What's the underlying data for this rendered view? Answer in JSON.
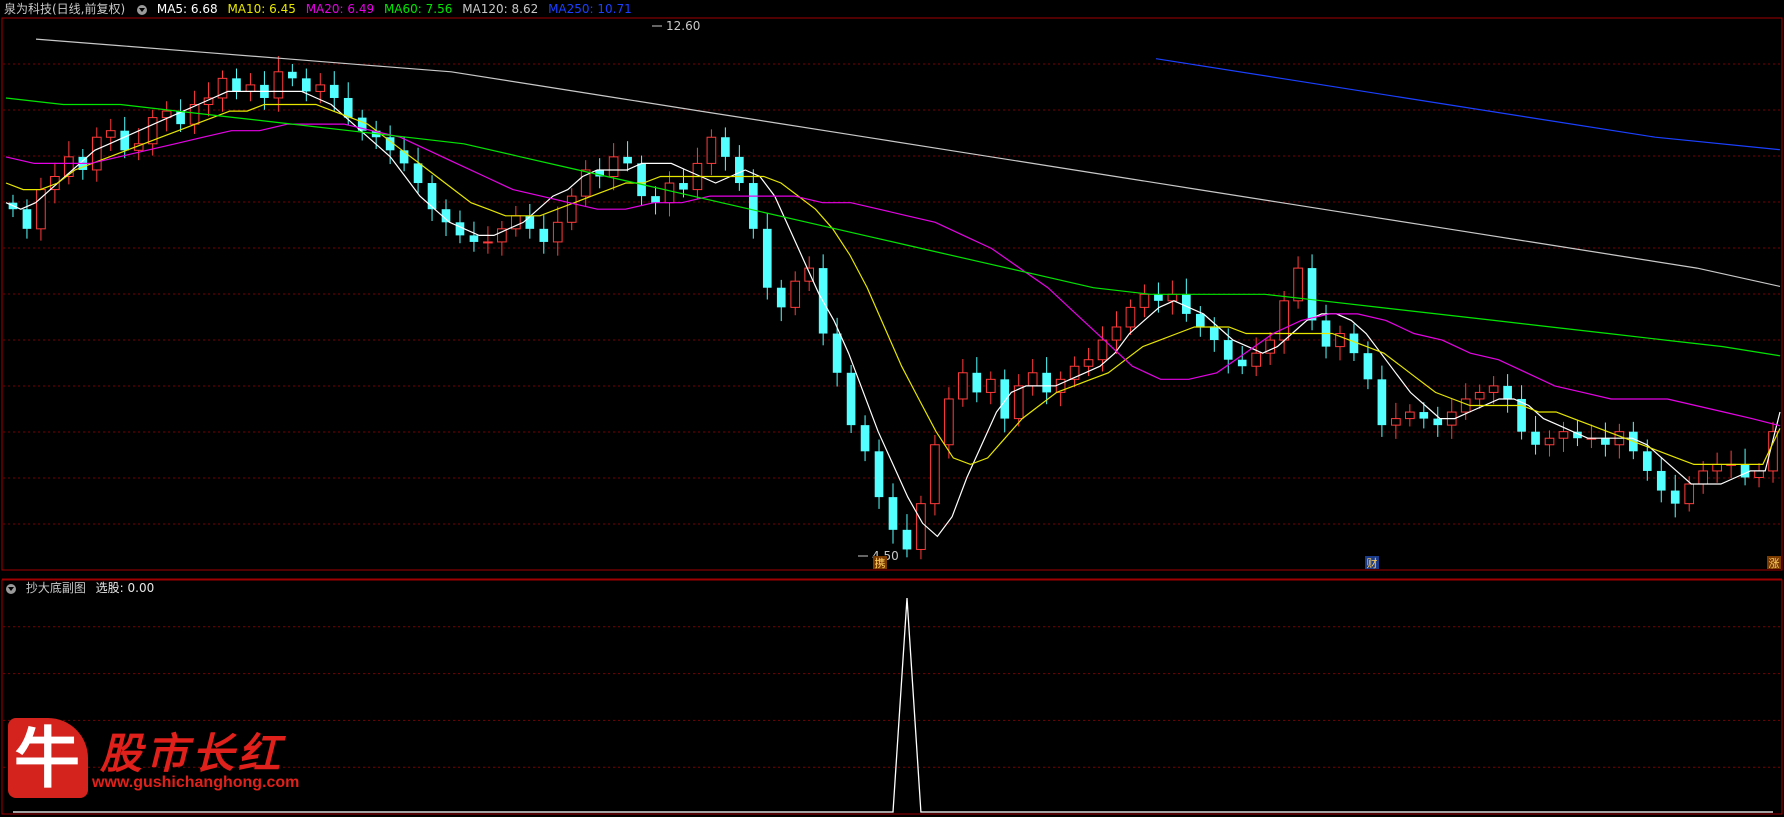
{
  "main_header": {
    "title": "泉为科技(日线,前复权)",
    "ma_items": [
      {
        "label": "MA5: 6.68",
        "color": "#ffffff"
      },
      {
        "label": "MA10: 6.45",
        "color": "#e6e600"
      },
      {
        "label": "MA20: 6.49",
        "color": "#e600e6"
      },
      {
        "label": "MA60: 7.56",
        "color": "#00e600"
      },
      {
        "label": "MA120: 8.62",
        "color": "#c8c8c8"
      },
      {
        "label": "MA250: 10.71",
        "color": "#1a40ff"
      }
    ]
  },
  "sub_header": {
    "title": "抄大底副图",
    "value_label": "选股: 0.00"
  },
  "markers": {
    "high_label": "12.60",
    "low_label": "4.50",
    "event_tags": [
      "携",
      "财",
      "涨"
    ]
  },
  "watermark": {
    "glyph": "牛",
    "title": "股市长红",
    "url": "www.gushichanghong.com"
  },
  "colors": {
    "up": "#ff3b3b",
    "down": "#54ffff",
    "grid": "#7a0000",
    "border": "#a00000",
    "signal": "#ffffff"
  },
  "chart_data": [
    {
      "type": "candlestick",
      "title": "泉为科技(日线,前复权)",
      "xlabel": "",
      "ylabel": "",
      "ylim": [
        4.5,
        12.6
      ],
      "grid": true,
      "high_point": 12.6,
      "low_point": 4.5,
      "candles_close": [
        9.8,
        9.5,
        10.1,
        10.3,
        10.6,
        10.4,
        10.9,
        11.0,
        10.7,
        10.8,
        11.2,
        11.3,
        11.1,
        11.4,
        11.5,
        11.8,
        11.6,
        11.7,
        11.5,
        11.9,
        11.8,
        11.6,
        11.7,
        11.5,
        11.2,
        11.0,
        10.9,
        10.7,
        10.5,
        10.2,
        9.8,
        9.6,
        9.4,
        9.3,
        9.3,
        9.5,
        9.7,
        9.5,
        9.3,
        9.6,
        10.0,
        10.4,
        10.3,
        10.6,
        10.5,
        10.0,
        9.9,
        10.2,
        10.1,
        10.5,
        10.9,
        10.6,
        10.2,
        9.5,
        8.6,
        8.3,
        8.7,
        8.9,
        7.9,
        7.3,
        6.5,
        6.1,
        5.4,
        4.9,
        4.6,
        5.3,
        6.2,
        6.9,
        7.3,
        7.0,
        7.2,
        6.6,
        7.1,
        7.3,
        7.0,
        7.2,
        7.4,
        7.5,
        7.8,
        8.0,
        8.3,
        8.5,
        8.4,
        8.5,
        8.2,
        8.0,
        7.8,
        7.5,
        7.4,
        7.6,
        7.8,
        8.4,
        8.9,
        8.1,
        7.7,
        7.9,
        7.6,
        7.2,
        6.5,
        6.6,
        6.7,
        6.6,
        6.5,
        6.7,
        6.9,
        7.0,
        7.1,
        6.9,
        6.4,
        6.2,
        6.3,
        6.4,
        6.3,
        6.3,
        6.2,
        6.4,
        6.1,
        5.8,
        5.5,
        5.3,
        5.6,
        5.8,
        5.9,
        5.9,
        5.7,
        5.8,
        6.4
      ],
      "series": [
        {
          "name": "MA5",
          "values": [
            9.9,
            9.8,
            9.9,
            10.1,
            10.3,
            10.5,
            10.7,
            10.8,
            10.9,
            11.0,
            11.1,
            11.2,
            11.3,
            11.4,
            11.5,
            11.6,
            11.6,
            11.6,
            11.6,
            11.6,
            11.6,
            11.5,
            11.4,
            11.2,
            11.0,
            10.8,
            10.6,
            10.3,
            10.0,
            9.8,
            9.6,
            9.5,
            9.4,
            9.4,
            9.5,
            9.6,
            9.8,
            10.0,
            10.1,
            10.3,
            10.4,
            10.4,
            10.4,
            10.5,
            10.5,
            10.5,
            10.4,
            10.3,
            10.2,
            10.3,
            10.4,
            10.3,
            10.0,
            9.5,
            9.0,
            8.5,
            8.1,
            7.6,
            7.0,
            6.4,
            5.9,
            5.4,
            5.0,
            4.8,
            5.1,
            5.7,
            6.2,
            6.7,
            7.0,
            7.1,
            7.1,
            7.1,
            7.2,
            7.3,
            7.4,
            7.6,
            7.9,
            8.1,
            8.3,
            8.4,
            8.3,
            8.2,
            8.0,
            7.8,
            7.7,
            7.6,
            7.7,
            7.9,
            8.1,
            8.2,
            8.2,
            8.1,
            7.9,
            7.6,
            7.3,
            7.0,
            6.8,
            6.6,
            6.6,
            6.7,
            6.8,
            6.9,
            6.9,
            6.8,
            6.6,
            6.5,
            6.4,
            6.3,
            6.3,
            6.3,
            6.3,
            6.2,
            6.0,
            5.8,
            5.6,
            5.6,
            5.6,
            5.7,
            5.8,
            5.8,
            6.7
          ]
        },
        {
          "name": "MA10",
          "values": [
            10.2,
            10.1,
            10.1,
            10.2,
            10.4,
            10.5,
            10.6,
            10.7,
            10.8,
            10.9,
            11.0,
            11.1,
            11.2,
            11.3,
            11.3,
            11.4,
            11.4,
            11.4,
            11.4,
            11.3,
            11.2,
            11.1,
            10.9,
            10.7,
            10.5,
            10.3,
            10.1,
            9.9,
            9.8,
            9.7,
            9.7,
            9.7,
            9.8,
            9.9,
            10.0,
            10.1,
            10.2,
            10.2,
            10.3,
            10.3,
            10.3,
            10.3,
            10.3,
            10.3,
            10.3,
            10.2,
            10.0,
            9.8,
            9.5,
            9.1,
            8.6,
            8.0,
            7.4,
            6.9,
            6.4,
            6.0,
            5.9,
            6.0,
            6.3,
            6.6,
            6.8,
            7.0,
            7.1,
            7.2,
            7.3,
            7.5,
            7.7,
            7.8,
            7.9,
            8.0,
            8.0,
            8.0,
            7.9,
            7.9,
            7.9,
            7.9,
            7.9,
            7.9,
            7.8,
            7.7,
            7.6,
            7.4,
            7.2,
            7.0,
            6.9,
            6.8,
            6.8,
            6.8,
            6.8,
            6.7,
            6.7,
            6.6,
            6.5,
            6.4,
            6.3,
            6.2,
            6.1,
            6.0,
            5.9,
            5.9,
            5.9,
            5.9,
            5.9,
            6.45
          ]
        },
        {
          "name": "MA20",
          "values": [
            10.6,
            10.5,
            10.5,
            10.5,
            10.6,
            10.7,
            10.8,
            10.9,
            11.0,
            11.0,
            11.1,
            11.1,
            11.1,
            11.0,
            10.9,
            10.7,
            10.5,
            10.3,
            10.1,
            10.0,
            9.9,
            9.8,
            9.8,
            9.9,
            9.9,
            10.0,
            10.0,
            10.0,
            10.0,
            9.9,
            9.9,
            9.8,
            9.7,
            9.6,
            9.4,
            9.2,
            8.9,
            8.6,
            8.2,
            7.8,
            7.4,
            7.2,
            7.2,
            7.3,
            7.6,
            7.9,
            8.1,
            8.2,
            8.2,
            8.1,
            7.9,
            7.8,
            7.6,
            7.5,
            7.3,
            7.1,
            7.0,
            6.9,
            6.9,
            6.9,
            6.8,
            6.7,
            6.6,
            6.49
          ]
        },
        {
          "name": "MA60",
          "values": [
            11.5,
            11.4,
            11.4,
            11.3,
            11.2,
            11.1,
            11.0,
            10.9,
            10.8,
            10.6,
            10.4,
            10.2,
            10.0,
            9.8,
            9.6,
            9.4,
            9.2,
            9.0,
            8.8,
            8.6,
            8.5,
            8.5,
            8.5,
            8.4,
            8.3,
            8.2,
            8.1,
            8.0,
            7.9,
            7.8,
            7.7,
            7.56
          ]
        },
        {
          "name": "MA120",
          "values": [
            12.4,
            12.3,
            12.2,
            12.1,
            12.0,
            11.9,
            11.7,
            11.5,
            11.3,
            11.1,
            10.9,
            10.7,
            10.5,
            10.3,
            10.1,
            9.9,
            9.7,
            9.5,
            9.3,
            9.1,
            8.9,
            8.62
          ]
        },
        {
          "name": "MA250",
          "values": [
            12.1,
            11.8,
            11.5,
            11.2,
            10.9,
            10.71
          ]
        }
      ]
    },
    {
      "type": "line",
      "title": "抄大底副图",
      "xlabel": "",
      "ylabel": "",
      "ylim": [
        0,
        1
      ],
      "grid": true,
      "series": [
        {
          "name": "选股",
          "values": [
            0,
            0,
            0,
            0,
            0,
            0,
            0,
            0,
            0,
            0,
            0,
            0,
            0,
            0,
            0,
            0,
            0,
            0,
            0,
            0,
            0,
            0,
            0,
            0,
            0,
            0,
            0,
            0,
            0,
            0,
            0,
            0,
            0,
            0,
            0,
            0,
            0,
            0,
            0,
            0,
            0,
            0,
            0,
            0,
            0,
            0,
            0,
            0,
            0,
            0,
            0,
            0,
            0,
            0,
            0,
            0,
            0,
            0,
            0,
            0,
            0,
            0,
            0,
            0,
            1,
            0,
            0,
            0,
            0,
            0,
            0,
            0,
            0,
            0,
            0,
            0,
            0,
            0,
            0,
            0,
            0,
            0,
            0,
            0,
            0,
            0,
            0,
            0,
            0,
            0,
            0,
            0,
            0,
            0,
            0,
            0,
            0,
            0,
            0,
            0,
            0,
            0,
            0,
            0,
            0,
            0,
            0,
            0,
            0,
            0,
            0,
            0,
            0,
            0,
            0,
            0,
            0,
            0,
            0,
            0,
            0,
            0,
            0,
            0,
            0,
            0,
            0
          ]
        }
      ]
    }
  ]
}
